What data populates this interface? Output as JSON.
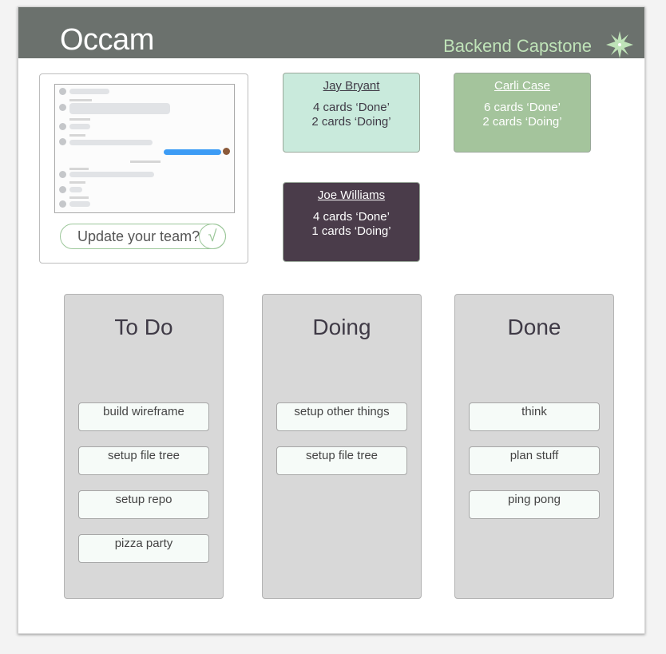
{
  "header": {
    "app_title": "Occam",
    "project_name": "Backend Capstone"
  },
  "update": {
    "label": "Update your team?",
    "check": "√"
  },
  "members": [
    {
      "name": "Jay Bryant",
      "done": "4 cards ‘Done’",
      "doing": "2 cards ‘Doing’",
      "bg": "#c9eadc",
      "text": "#3f3a46"
    },
    {
      "name": "Carli Case",
      "done": "6 cards ‘Done’",
      "doing": "2 cards ‘Doing’",
      "bg": "#a4c49c",
      "text": "#ffffff"
    },
    {
      "name": "Joe Williams",
      "done": "4 cards ‘Done’",
      "doing": "1 cards ‘Doing’",
      "bg": "#4a3c4a",
      "text": "#ffffff"
    }
  ],
  "columns": [
    {
      "title": "To Do",
      "cards": [
        "build wireframe",
        "setup file tree",
        "setup repo",
        "pizza party"
      ]
    },
    {
      "title": "Doing",
      "cards": [
        "setup other things",
        "setup file tree"
      ]
    },
    {
      "title": "Done",
      "cards": [
        "think",
        "plan stuff",
        "ping pong"
      ]
    }
  ],
  "colors": {
    "header": "#6b716d",
    "accent": "#9cc79a"
  }
}
